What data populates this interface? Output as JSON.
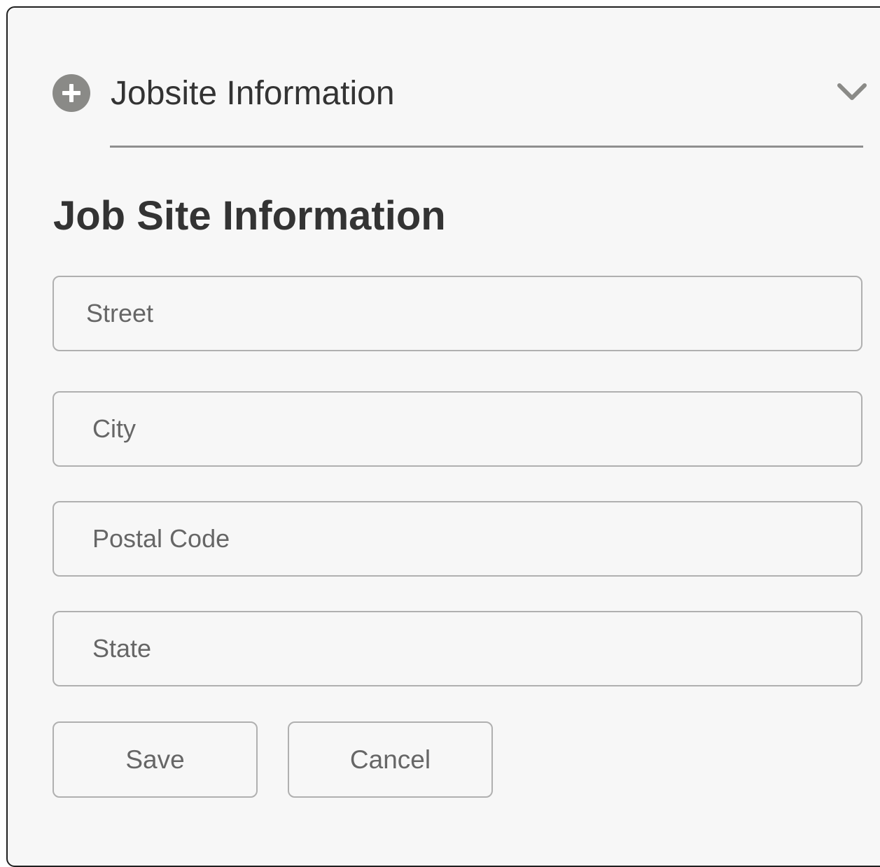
{
  "section": {
    "title": "Jobsite Information",
    "expand_icon": "plus-circle-icon",
    "collapse_icon": "chevron-down-icon"
  },
  "form": {
    "heading": "Job Site Information",
    "fields": {
      "street": {
        "placeholder": "Street",
        "value": ""
      },
      "city": {
        "placeholder": "City",
        "value": ""
      },
      "postal_code": {
        "placeholder": "Postal Code",
        "value": ""
      },
      "state": {
        "placeholder": "State",
        "value": ""
      }
    },
    "buttons": {
      "save_label": "Save",
      "cancel_label": "Cancel"
    }
  },
  "colors": {
    "panel_background": "#f7f7f7",
    "panel_border": "#1f1f1f",
    "icon_gray": "#8a8a87",
    "text_dark": "#333333",
    "field_border": "#b0b0b0"
  }
}
